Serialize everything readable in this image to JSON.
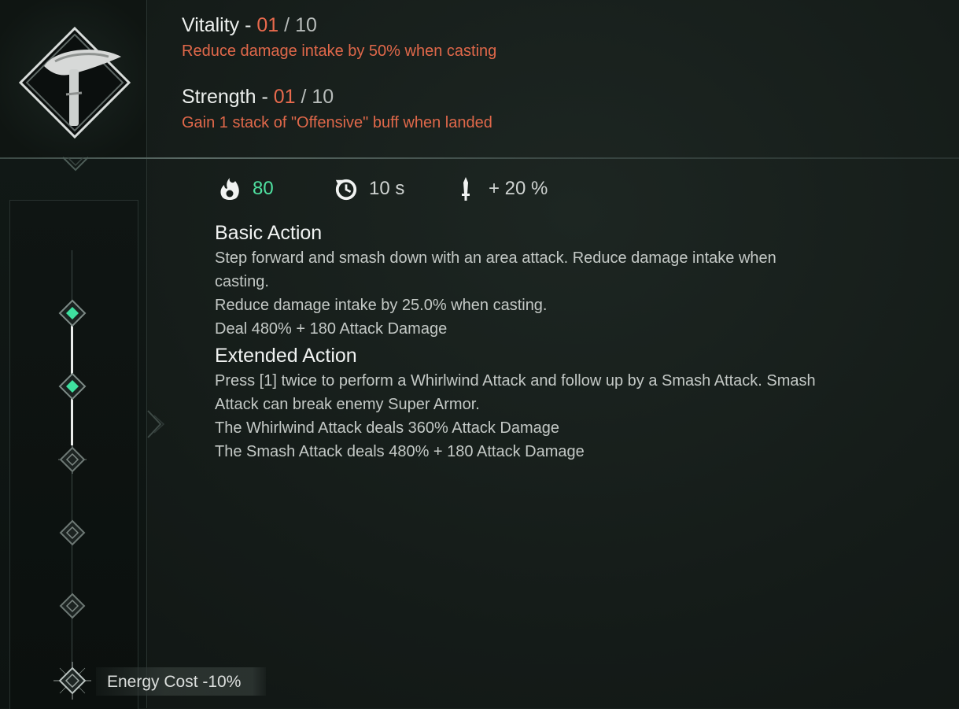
{
  "attributes": [
    {
      "name": "Vitality",
      "dash": " - ",
      "current": "01",
      "sep": " / ",
      "max": "10",
      "effect": "Reduce damage intake by 50% when casting"
    },
    {
      "name": "Strength",
      "dash": " - ",
      "current": "01",
      "sep": " / ",
      "max": "10",
      "effect": "Gain 1 stack of \"Offensive\" buff when landed"
    }
  ],
  "stats": {
    "energy": {
      "icon": "flame-icon",
      "value": "80"
    },
    "cooldown": {
      "icon": "cooldown-clock-icon",
      "value": "10 s"
    },
    "damage_bonus": {
      "icon": "dagger-icon",
      "value": "+ 20 %"
    }
  },
  "basic_action": {
    "title": "Basic Action",
    "lines": [
      "Step forward and smash down with an area attack. Reduce damage intake when",
      "casting.",
      "Reduce damage intake by 25.0% when casting.",
      "Deal 480% + 180 Attack Damage"
    ]
  },
  "extended_action": {
    "title": "Extended Action",
    "lines": [
      "Press [1] twice to perform a Whirlwind Attack and follow up by a Smash Attack.  Smash",
      "Attack can break enemy Super Armor.",
      "The Whirlwind Attack deals 360% Attack Damage",
      "The Smash Attack deals 480% + 180 Attack Damage"
    ]
  },
  "skill_icon": "warhammer-icon",
  "progression": {
    "nodes": [
      "active",
      "active",
      "locked",
      "locked",
      "locked",
      "locked"
    ],
    "selected_label": "Energy Cost -10%"
  },
  "colors": {
    "accent_orange": "#e86a4d",
    "accent_green": "#4fe0a0",
    "background": "#151c19"
  }
}
